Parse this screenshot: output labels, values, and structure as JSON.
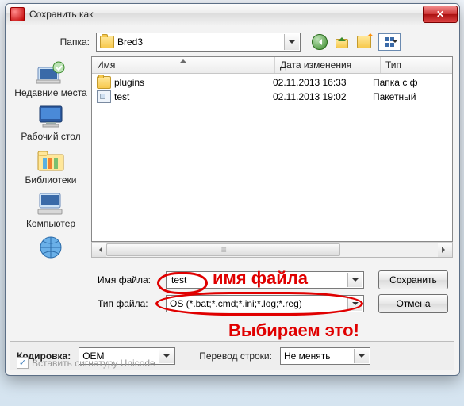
{
  "window": {
    "title": "Сохранить как"
  },
  "folder": {
    "label": "Папка:",
    "value": "Bred3"
  },
  "places": {
    "recent": "Недавние места",
    "desktop": "Рабочий стол",
    "libraries": "Библиотеки",
    "computer": "Компьютер"
  },
  "columns": {
    "name": "Имя",
    "date": "Дата изменения",
    "type": "Тип"
  },
  "files": [
    {
      "icon": "folder",
      "name": "plugins",
      "date": "02.11.2013 16:33",
      "type": "Папка с ф"
    },
    {
      "icon": "reg",
      "name": "test",
      "date": "02.11.2013 19:02",
      "type": "Пакетный"
    }
  ],
  "filename": {
    "label": "Имя файла:",
    "value": "test"
  },
  "filetype": {
    "label": "Тип файла:",
    "value": "OS (*.bat;*.cmd;*.ini;*.log;*.reg)"
  },
  "buttons": {
    "save": "Сохранить",
    "cancel": "Отмена"
  },
  "encoding": {
    "label": "Кодировка:",
    "value": "OEM"
  },
  "lineend": {
    "label": "Перевод строки:",
    "value": "Не менять"
  },
  "unicode_sig": {
    "label": "Вставить сигнатуру Unicode",
    "checked": true
  },
  "annotations": {
    "filename_hint": "имя файла",
    "choose_hint": "Выбираем это!"
  }
}
